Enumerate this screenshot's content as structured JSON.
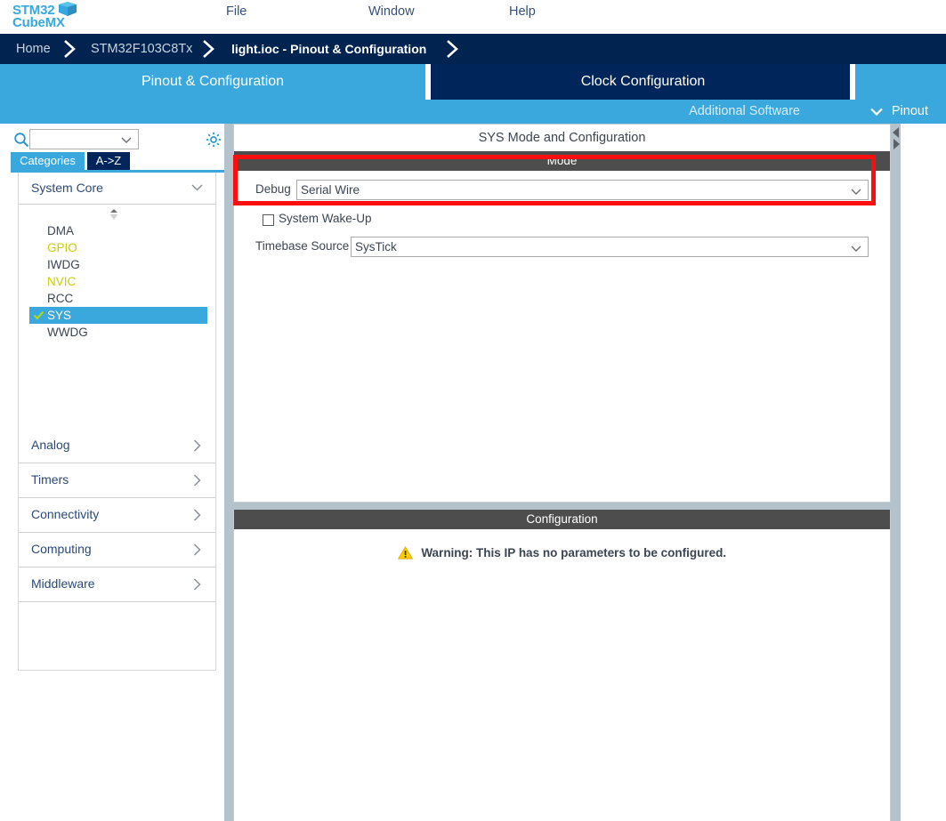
{
  "app": {
    "logo_line1": "STM32",
    "logo_line1_small": "",
    "logo_line2": "CubeMX"
  },
  "menu": {
    "file": "File",
    "window": "Window",
    "help": "Help"
  },
  "breadcrumb": {
    "home": "Home",
    "device": "STM32F103C8Tx",
    "current": "light.ioc - Pinout & Configuration"
  },
  "tabs": {
    "pinout_configuration": "Pinout & Configuration",
    "clock_configuration": "Clock Configuration",
    "spacer": ""
  },
  "subbar": {
    "additional_software": "Additional Software",
    "pinout": "Pinout"
  },
  "sidebar": {
    "search_value": "",
    "search_placeholder": "",
    "tabs": {
      "categories": "Categories",
      "a_to_z": "A->Z"
    },
    "system_core": {
      "label": "System Core",
      "items": [
        {
          "label": "DMA",
          "state": "normal",
          "checked": false
        },
        {
          "label": "GPIO",
          "state": "warn",
          "checked": false
        },
        {
          "label": "IWDG",
          "state": "normal",
          "checked": false
        },
        {
          "label": "NVIC",
          "state": "warn",
          "checked": false
        },
        {
          "label": "RCC",
          "state": "normal",
          "checked": false
        },
        {
          "label": "SYS",
          "state": "selected",
          "checked": true
        },
        {
          "label": "WWDG",
          "state": "normal",
          "checked": false
        }
      ]
    },
    "categories": [
      {
        "label": "Analog"
      },
      {
        "label": "Timers"
      },
      {
        "label": "Connectivity"
      },
      {
        "label": "Computing"
      },
      {
        "label": "Middleware"
      }
    ]
  },
  "main": {
    "panel_title": "SYS Mode and Configuration",
    "mode_bar": "Mode",
    "debug_label": "Debug",
    "debug_value": "Serial Wire",
    "wakeup_label": "System Wake-Up",
    "wakeup_checked": false,
    "timebase_label": "Timebase Source",
    "timebase_value": "SysTick",
    "config_bar": "Configuration",
    "warning_text": "Warning: This IP has no parameters to be configured."
  },
  "colors": {
    "accent_light_blue": "#3aa8dc",
    "navy": "#002350",
    "warn_yellow": "#cccc00",
    "annotation_red": "#fd0d0d",
    "bar_gray": "#4d4d4d"
  }
}
